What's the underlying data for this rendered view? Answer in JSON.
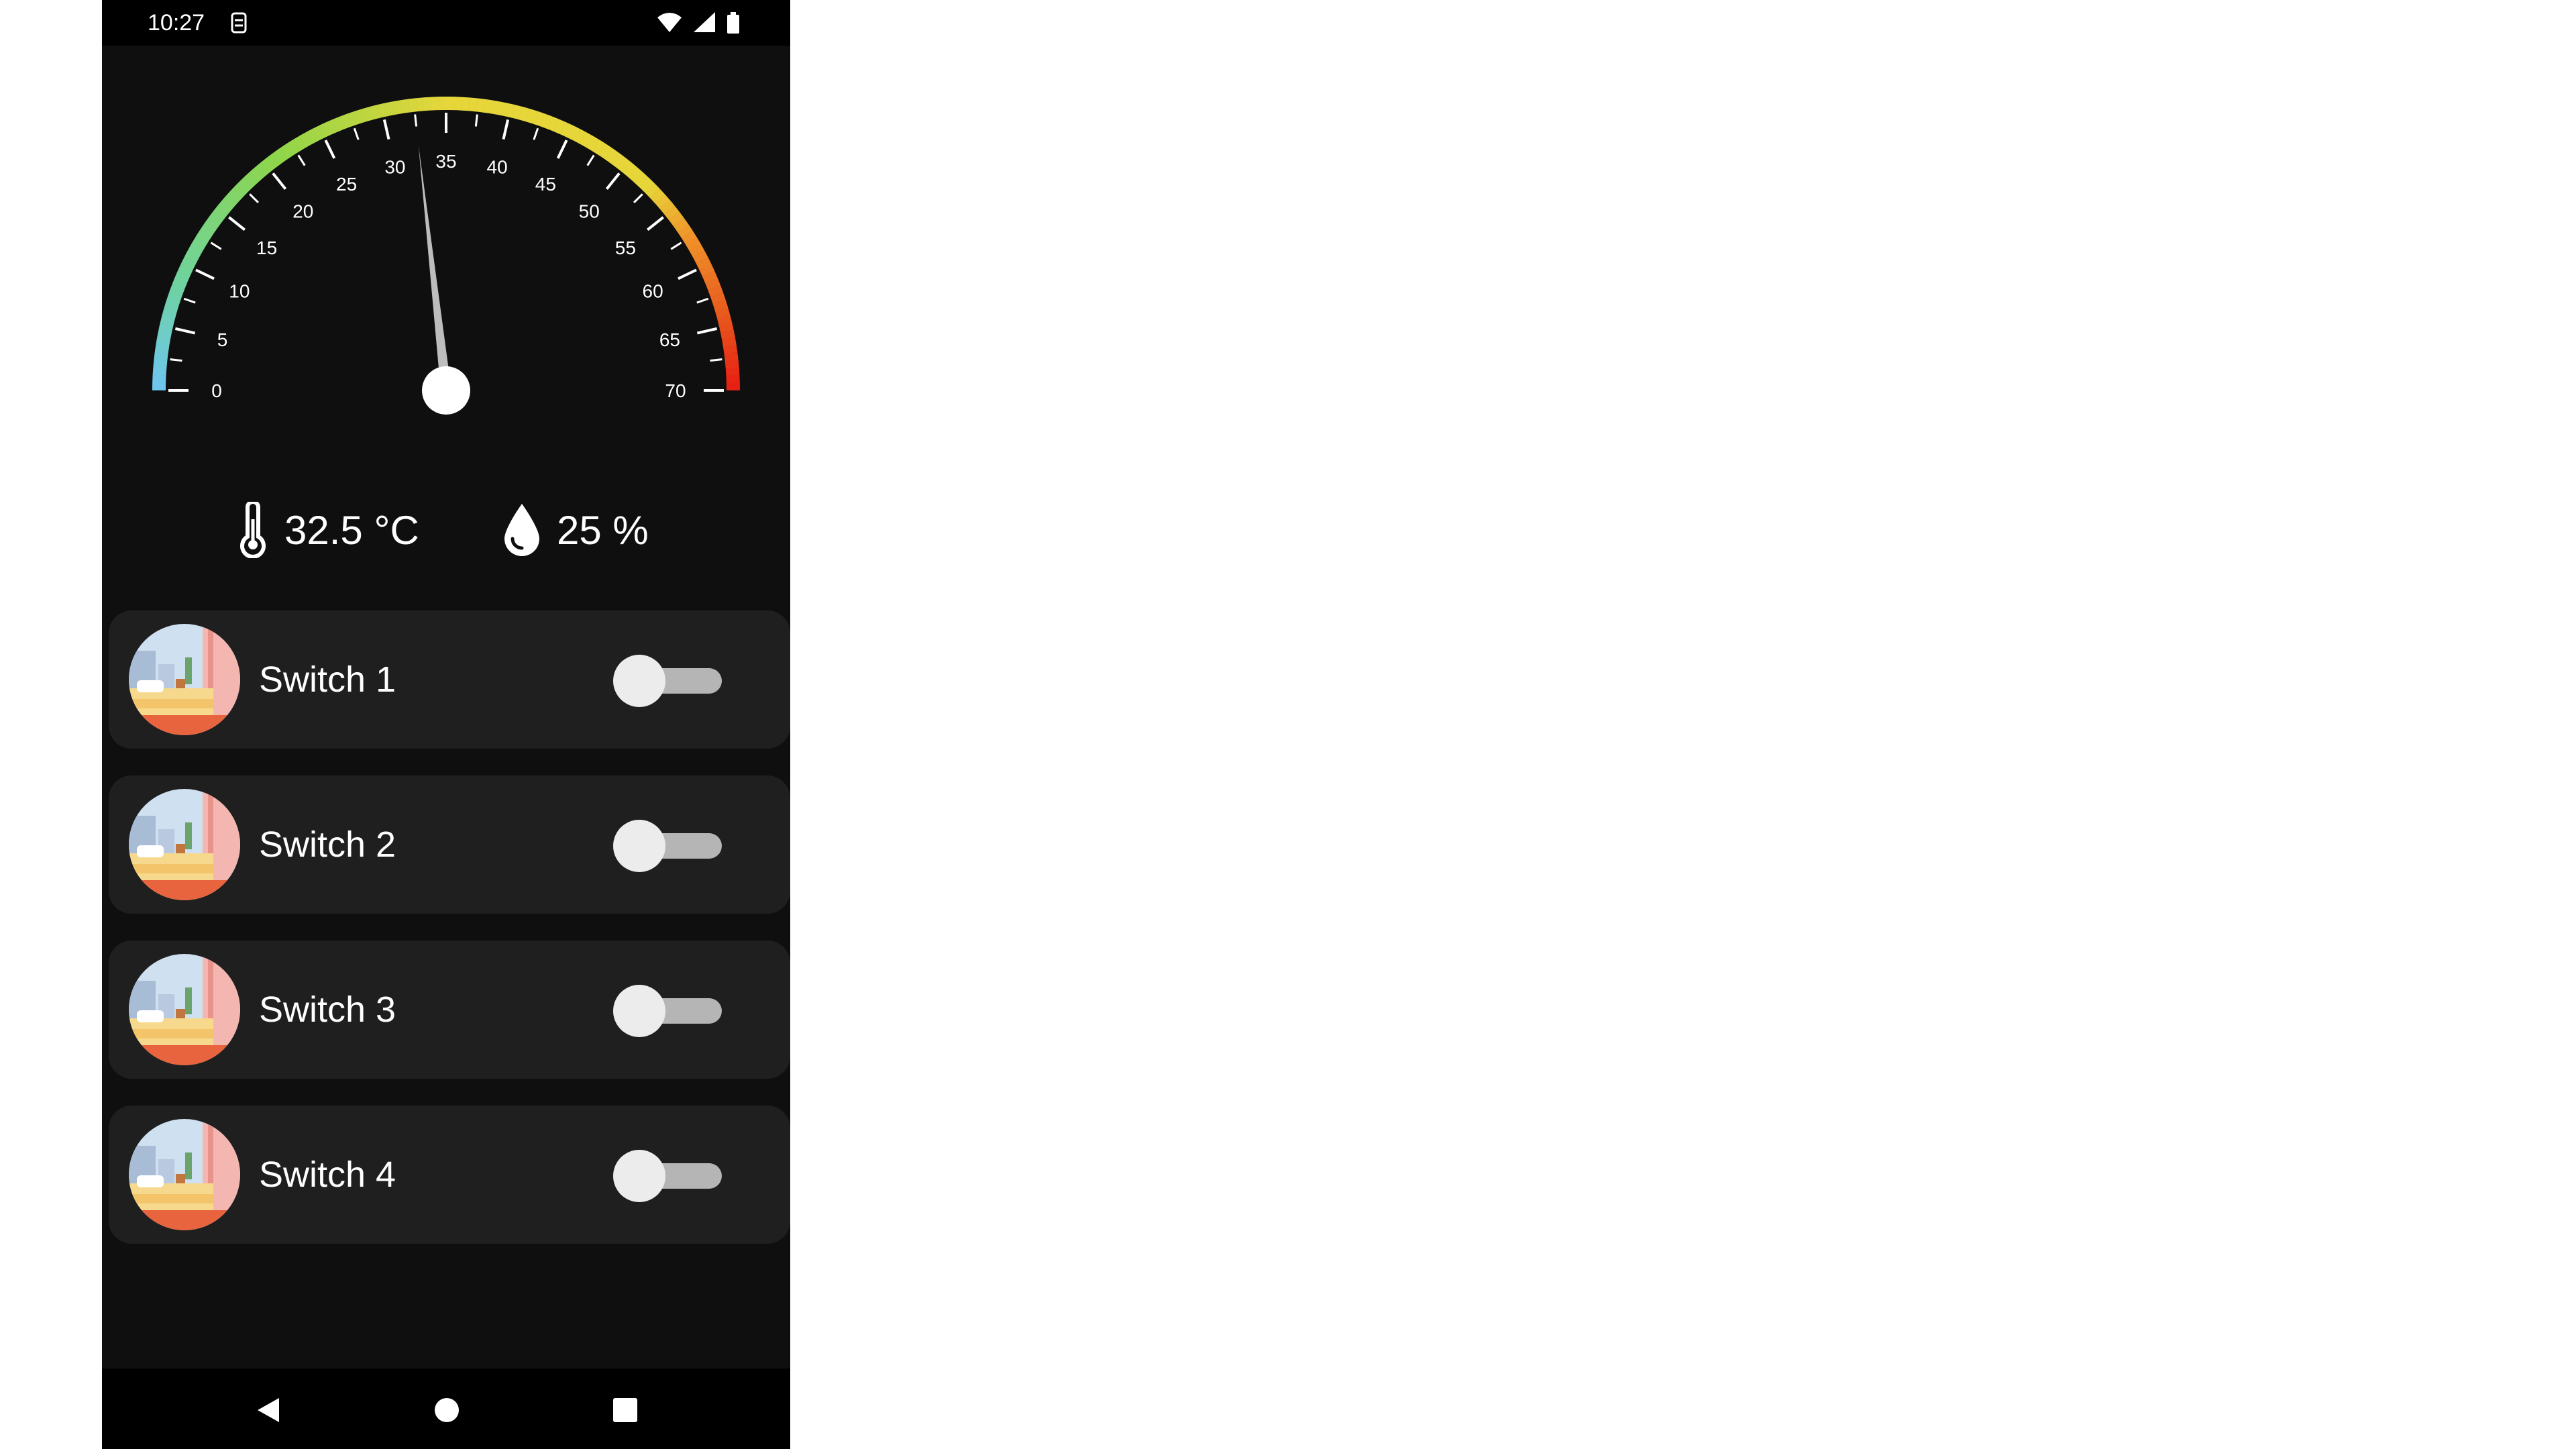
{
  "status_bar": {
    "time": "10:27"
  },
  "gauge": {
    "min": 0,
    "max": 70,
    "value": 32.5,
    "tick_labels": [
      "0",
      "5",
      "10",
      "15",
      "20",
      "25",
      "30",
      "35",
      "40",
      "45",
      "50",
      "55",
      "60",
      "65",
      "70"
    ],
    "colors": {
      "cold": "#6ec6f2",
      "cool": "#6fd3a0",
      "green": "#8ed64a",
      "yellow": "#e6d63a",
      "orange": "#f0942a",
      "red": "#e81c12",
      "needle": "#bdbdbd",
      "hub": "#ffffff"
    }
  },
  "readings": {
    "temperature": "32.5 °C",
    "humidity": "25 %"
  },
  "switches": [
    {
      "label": "Switch 1",
      "on": false
    },
    {
      "label": "Switch 2",
      "on": false
    },
    {
      "label": "Switch 3",
      "on": false
    },
    {
      "label": "Switch 4",
      "on": false
    }
  ],
  "icons": {
    "status_notification": "sim-icon",
    "wifi": "wifi-icon",
    "signal": "signal-icon",
    "battery": "battery-icon",
    "temperature": "thermometer-icon",
    "humidity": "water-drop-icon",
    "back": "back-icon",
    "home": "home-icon",
    "recents": "recents-icon"
  }
}
